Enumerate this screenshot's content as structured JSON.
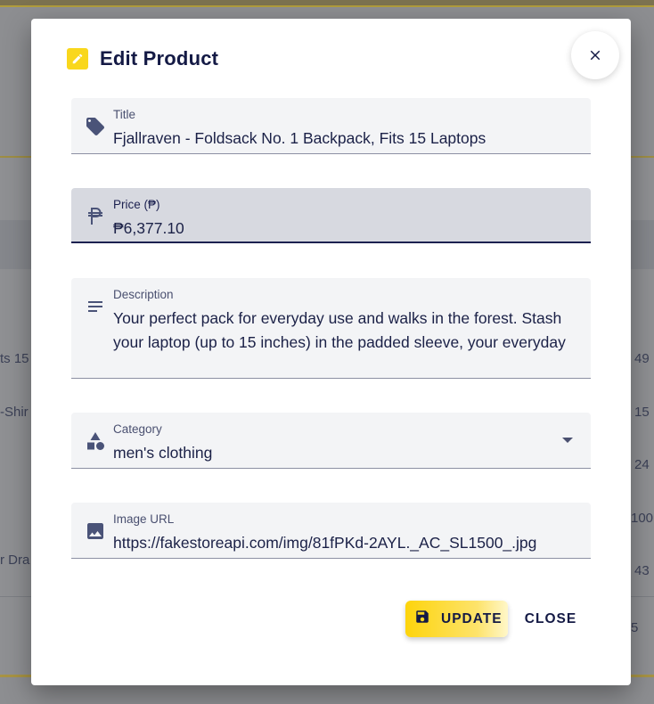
{
  "background": {
    "left_snippets": [
      "ts 15",
      "-Shir",
      "r Dra"
    ],
    "right_numbers": [
      "49",
      "15",
      "24",
      "100",
      "43",
      "5"
    ]
  },
  "modal": {
    "title": "Edit Product",
    "title_icon": "pencil-icon",
    "close_icon": "close-icon"
  },
  "fields": {
    "title": {
      "label": "Title",
      "value": "Fjallraven - Foldsack No. 1 Backpack, Fits 15 Laptops",
      "icon": "tag-icon"
    },
    "price": {
      "label": "Price (₱)",
      "value": "₱6,377.10",
      "icon": "peso-icon"
    },
    "description": {
      "label": "Description",
      "value": "Your perfect pack for everyday use and walks in the forest. Stash your laptop (up to 15 inches) in the padded sleeve, your everyday",
      "icon": "notes-icon"
    },
    "category": {
      "label": "Category",
      "value": "men's clothing",
      "icon": "category-icon"
    },
    "image_url": {
      "label": "Image URL",
      "value": "https://fakestoreapi.com/img/81fPKd-2AYL._AC_SL1500_.jpg",
      "icon": "image-icon"
    }
  },
  "actions": {
    "update_label": "UPDATE",
    "close_label": "CLOSE"
  },
  "colors": {
    "accent": "#fdd40c",
    "navy": "#141a45",
    "field_bg": "#f3f4f6"
  }
}
